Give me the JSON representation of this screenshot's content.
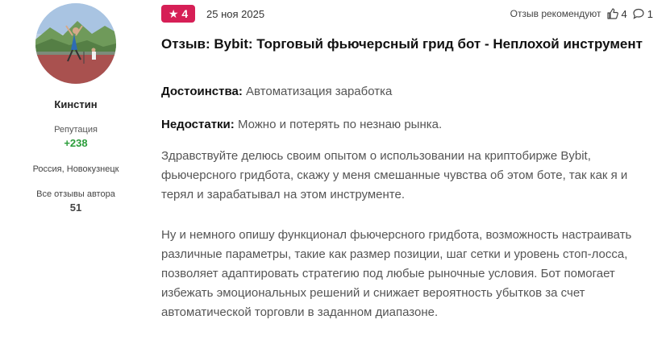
{
  "author": {
    "name": "Кинстин",
    "reputation_label": "Репутация",
    "reputation_value": "+238",
    "location": "Россия, Новокузнецк",
    "reviews_label": "Все отзывы автора",
    "reviews_count": "51",
    "avatar_icon": "avatar-photo"
  },
  "review": {
    "rating": "4",
    "date": "25 ноя 2025",
    "recommend_label": "Отзыв рекомендуют",
    "likes": "4",
    "comments": "1",
    "title": "Отзыв: Bybit: Торговый фьючерсный грид бот - Неплохой инструмент",
    "pros_label": "Достоинства:",
    "pros_text": "Автоматизация заработка",
    "cons_label": "Недостатки:",
    "cons_text": "Можно и потерять по незнаю рынка.",
    "paragraph_1": "Здравствуйте делюсь своим опытом о использовании на криптобирже Bybit, фьючерсного гридбота, скажу у меня смешанные чувства об этом боте, так как я и терял и зарабатывал на этом инструменте.",
    "paragraph_2": "Ну и немного опишу функционал фьючерсного гридбота, возможность настраивать различные параметры, такие как размер позиции, шаг сетки и уровень стоп-лосса, позволяет адаптировать стратегию под любые рыночные условия. Бот помогает избежать эмоциональных решений и снижает вероятность убытков за счет автоматической торговли в заданном диапазоне."
  },
  "colors": {
    "badge": "#d61f56",
    "reputation": "#2a9d3a"
  }
}
